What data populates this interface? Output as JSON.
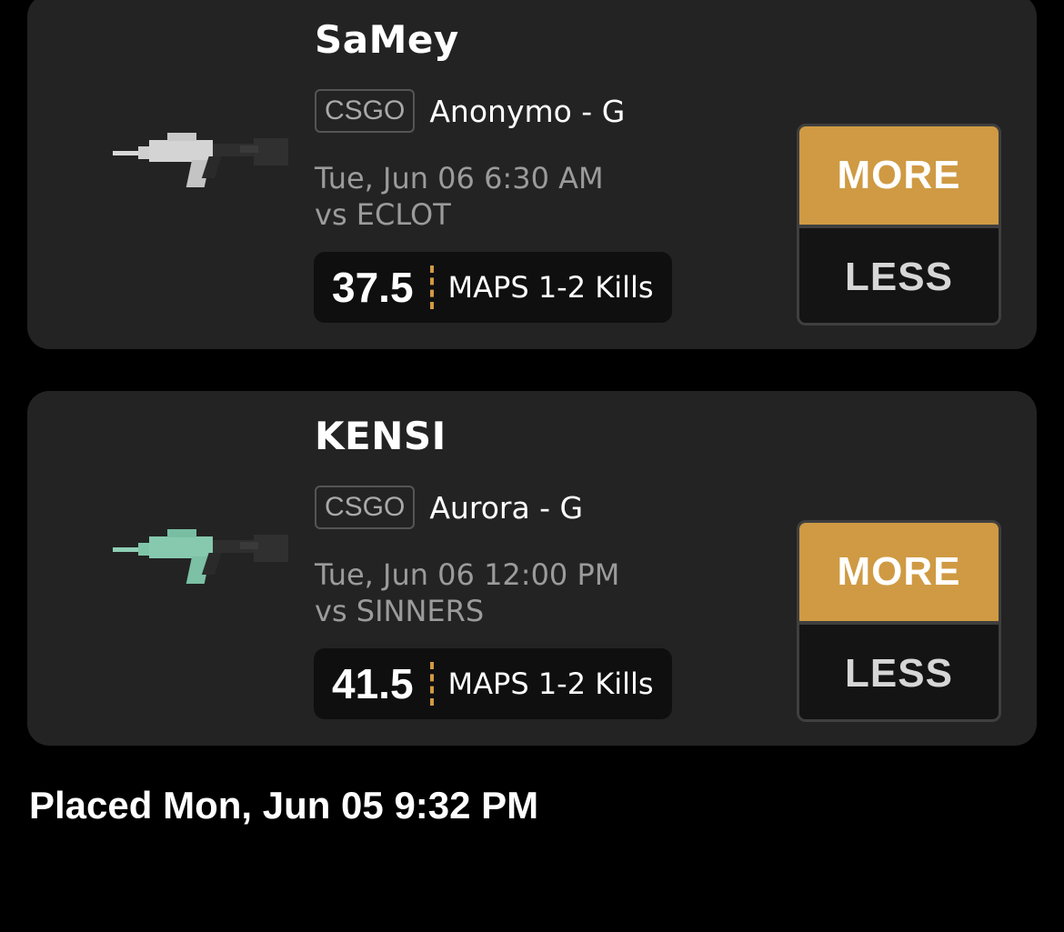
{
  "picks": [
    {
      "player": "SaMey",
      "league": "CSGO",
      "team_position": "Anonymo - G",
      "game_time": "Tue, Jun 06 6:30 AM",
      "opponent": "vs ECLOT",
      "line": "37.5",
      "stat": "MAPS 1-2 Kills",
      "more_label": "MORE",
      "less_label": "LESS",
      "image_icon": "rifle-icon-gray"
    },
    {
      "player": "KENSI",
      "league": "CSGO",
      "team_position": "Aurora - G",
      "game_time": "Tue, Jun 06 12:00 PM",
      "opponent": "vs SINNERS",
      "line": "41.5",
      "stat": "MAPS 1-2 Kills",
      "more_label": "MORE",
      "less_label": "LESS",
      "image_icon": "rifle-icon-teal"
    }
  ],
  "placed_text": "Placed Mon, Jun 05 9:32 PM",
  "colors": {
    "accent": "#cf9a43",
    "card_bg": "#232323",
    "rifle_gray": "#cfcfcf",
    "rifle_teal": "#86c9ae"
  }
}
